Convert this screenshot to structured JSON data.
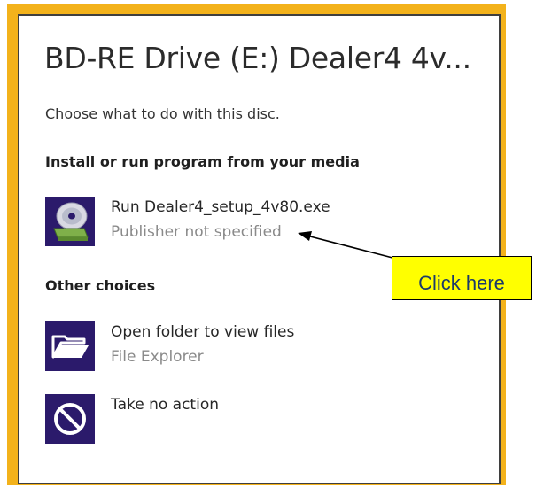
{
  "dialog": {
    "title": "BD-RE Drive (E:) Dealer4 4v...",
    "prompt": "Choose what to do with this disc."
  },
  "sections": [
    {
      "heading": "Install or run program from your media",
      "options": [
        {
          "icon": "disc-install-icon",
          "primary": "Run Dealer4_setup_4v80.exe",
          "secondary": "Publisher not specified"
        }
      ]
    },
    {
      "heading": "Other choices",
      "options": [
        {
          "icon": "folder-open-icon",
          "primary": "Open folder to view files",
          "secondary": "File Explorer"
        },
        {
          "icon": "no-action-icon",
          "primary": "Take no action",
          "secondary": ""
        }
      ]
    }
  ],
  "annotation": {
    "callout_text": "Click here"
  },
  "colors": {
    "frame": "#f3b21b",
    "tile": "#2b1a6b",
    "callout": "#ffff00",
    "callout_text": "#1b3a6b"
  }
}
